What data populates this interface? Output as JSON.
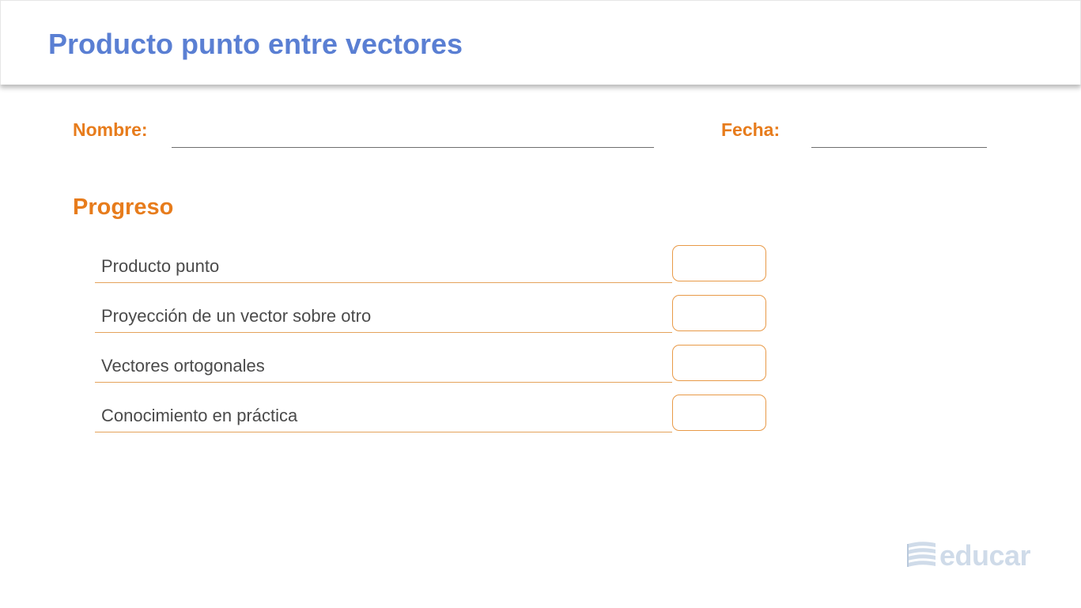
{
  "header": {
    "title": "Producto punto entre vectores"
  },
  "form": {
    "name_label": "Nombre:",
    "date_label": "Fecha:"
  },
  "progress": {
    "title": "Progreso",
    "items": [
      {
        "label": "Producto punto"
      },
      {
        "label": "Proyección de un vector sobre otro"
      },
      {
        "label": "Vectores ortogonales"
      },
      {
        "label": "Conocimiento en práctica"
      }
    ]
  },
  "logo": {
    "text": "educar",
    "icon": "stacked-books-icon"
  },
  "colors": {
    "title_blue": "#5a7fd3",
    "accent_orange": "#e77c1c",
    "logo_gray_blue": "#cfdbe9"
  }
}
